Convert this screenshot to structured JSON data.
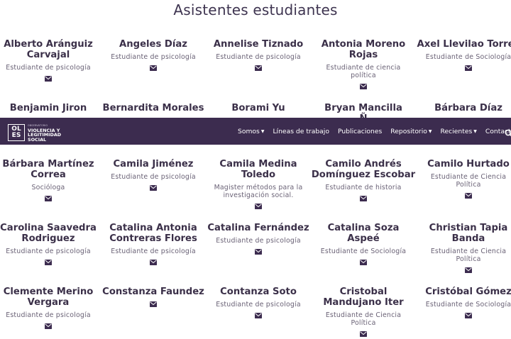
{
  "heading": "Asistentes estudiantes",
  "nav": {
    "logo_mark_top": "OL",
    "logo_mark_bottom": "ES",
    "logo_sub": "OBSERVATORIO",
    "logo_line1": "VIOLENCIA Y",
    "logo_line2": "LEGITIMIDAD",
    "logo_line3": "SOCIAL",
    "items": [
      {
        "label": "Somos",
        "dropdown": true
      },
      {
        "label": "Líneas de trabajo",
        "dropdown": false
      },
      {
        "label": "Publicaciones",
        "dropdown": false
      },
      {
        "label": "Repositorio",
        "dropdown": true
      },
      {
        "label": "Recientes",
        "dropdown": true
      },
      {
        "label": "Contacto",
        "dropdown": false
      }
    ],
    "caret": "▼"
  },
  "rows": [
    [
      {
        "name": "Alberto Aránguiz\nCarvajal",
        "role": "Estudiante de psicología"
      },
      {
        "name": "Angeles Díaz",
        "role": "Estudiante de psicología"
      },
      {
        "name": "Annelise Tiznado",
        "role": "Estudiante de psicología"
      },
      {
        "name": "Antonia Moreno\nRojas",
        "role": "Estudiante de ciencia\npolítica"
      },
      {
        "name": "Axel Llevilao Torres",
        "role": "Estudiante de Sociología"
      }
    ],
    [
      {
        "name": "Benjamin Jiron",
        "role": ""
      },
      {
        "name": "Bernardita Morales",
        "role": ""
      },
      {
        "name": "Borami Yu",
        "role": ""
      },
      {
        "name": "Bryan Mancilla\nÑ",
        "role": ""
      },
      {
        "name": "Bárbara Díaz",
        "role": ""
      }
    ],
    [
      {
        "name": "Bárbara Martínez\nCorrea",
        "role": "Socióloga"
      },
      {
        "name": "Camila Jiménez",
        "role": "Estudiante de psicología"
      },
      {
        "name": "Camila Medina\nToledo",
        "role": "Magister métodos para la\ninvestigación social."
      },
      {
        "name": "Camilo Andrés\nDomínguez Escobar",
        "role": "Estudiante de historia"
      },
      {
        "name": "Camilo Hurtado",
        "role": "Estudiante de Ciencia\nPolítica"
      }
    ],
    [
      {
        "name": "Carolina Saavedra\nRodriguez",
        "role": "Estudiante de psicología"
      },
      {
        "name": "Catalina Antonia\nContreras Flores",
        "role": "Estudiante de psicología"
      },
      {
        "name": "Catalina Fernández",
        "role": "Estudiante de psicología"
      },
      {
        "name": "Catalina Soza\nAspeé",
        "role": "Estudiante de Sociología"
      },
      {
        "name": "Christian Tapia\nBanda",
        "role": "Estudiante de Ciencia\nPolítica"
      }
    ],
    [
      {
        "name": "Clemente Merino\nVergara",
        "role": "Estudiante de psicología"
      },
      {
        "name": "Constanza Faundez",
        "role": ""
      },
      {
        "name": "Contanza Soto",
        "role": "Estudiante de psicología"
      },
      {
        "name": "Cristobal\nMandujano Iter",
        "role": "Estudiante de Ciencia\nPolítica"
      },
      {
        "name": "Cristóbal Gómez",
        "role": "Estudiante de Sociología"
      }
    ]
  ]
}
